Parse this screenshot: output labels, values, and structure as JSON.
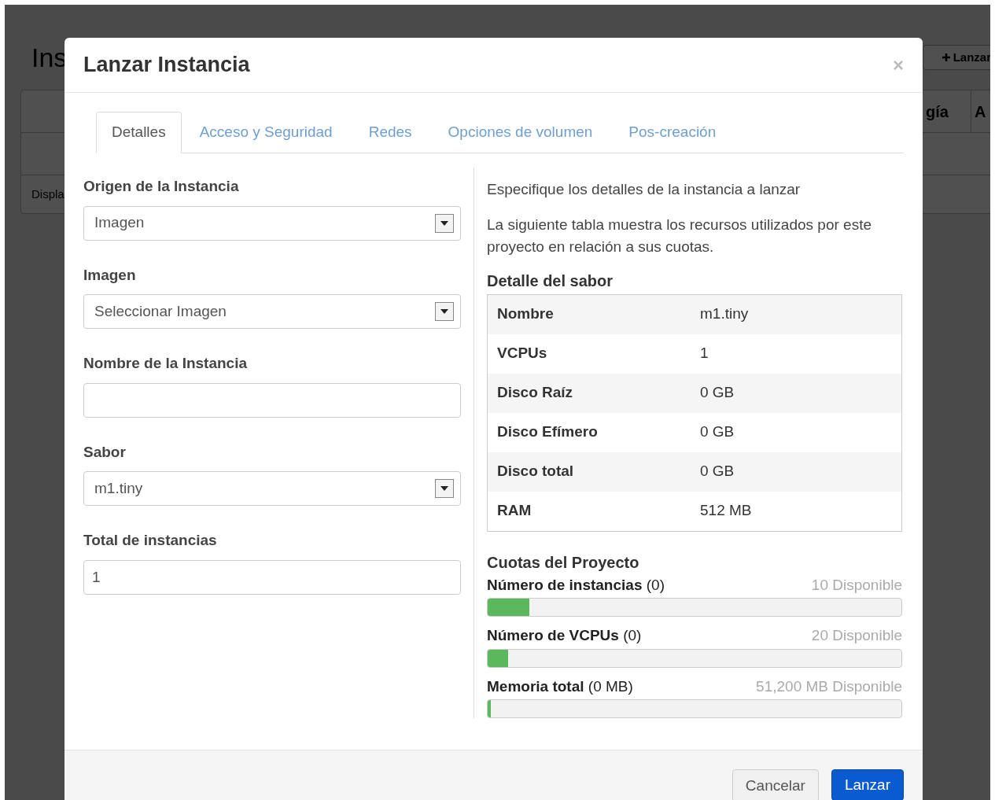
{
  "background": {
    "title": "Ins",
    "launch_button": "Lanzar",
    "table_headers": [
      "gía",
      "A"
    ],
    "row_text": "Displa"
  },
  "modal": {
    "title": "Lanzar Instancia",
    "close": "×",
    "tabs": [
      {
        "label": "Detalles",
        "selected": true
      },
      {
        "label": "Acceso y Seguridad",
        "selected": false
      },
      {
        "label": "Redes",
        "selected": false
      },
      {
        "label": "Opciones de volumen",
        "selected": false
      },
      {
        "label": "Pos-creación",
        "selected": false
      }
    ],
    "fields": [
      {
        "label": "Origen de la Instancia",
        "kind": "select",
        "value": "Imagen"
      },
      {
        "label": "Imagen",
        "kind": "select",
        "value": "Seleccionar Imagen"
      },
      {
        "label": "Nombre de la Instancia",
        "kind": "input"
      },
      {
        "label": "Sabor",
        "kind": "select",
        "value": "m1.tiny"
      },
      {
        "label": "Total de instancias",
        "kind": "input",
        "value": "1"
      }
    ],
    "intro": "Especifique los detalles de la instancia a lanzar",
    "description": "La siguiente tabla muestra los recursos utilizados por este proyecto en relación a sus cuotas.",
    "flavor_title": "Detalle del sabor",
    "flavor_rows": [
      {
        "name": "Nombre",
        "value": "m1.tiny"
      },
      {
        "name": "VCPUs",
        "value": "1"
      },
      {
        "name": "Disco Raíz",
        "value": "0 GB"
      },
      {
        "name": "Disco Efímero",
        "value": "0 GB"
      },
      {
        "name": "Disco total",
        "value": "0 GB"
      },
      {
        "name": "RAM",
        "value": "512 MB"
      }
    ],
    "quota_title": "Cuotas del Proyecto",
    "quotas": [
      {
        "label": "**Número de instancias** (0)",
        "available": "10 Disponible",
        "level": 0.1
      },
      {
        "label": "**Número de VCPUs** (0)",
        "available": "20 Disponible",
        "level": 0.05
      },
      {
        "label": "**Memoria total** (0 MB)",
        "available": "51,200 MB Disponible",
        "level": 0.008
      }
    ],
    "buttons": [
      {
        "label": "Cancelar",
        "kind": "default"
      },
      {
        "label": "Lanzar",
        "kind": "primary"
      }
    ]
  }
}
